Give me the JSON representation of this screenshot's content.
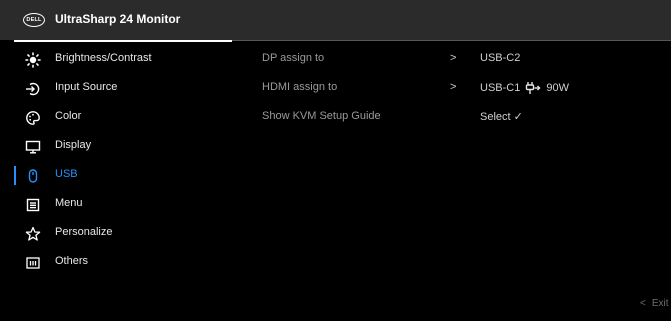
{
  "header": {
    "logo_text": "DELL",
    "title": "UltraSharp 24 Monitor"
  },
  "menu": [
    {
      "label": "Brightness/Contrast",
      "icon": "sun-icon"
    },
    {
      "label": "Input Source",
      "icon": "input-source-icon"
    },
    {
      "label": "Color",
      "icon": "palette-icon"
    },
    {
      "label": "Display",
      "icon": "monitor-icon"
    },
    {
      "label": "USB",
      "icon": "mouse-icon",
      "active": true
    },
    {
      "label": "Menu",
      "icon": "menu-icon"
    },
    {
      "label": "Personalize",
      "icon": "star-icon"
    },
    {
      "label": "Others",
      "icon": "info-icon"
    }
  ],
  "settings": [
    {
      "name": "DP assign to",
      "chevron": ">",
      "value": "USB-C2"
    },
    {
      "name": "HDMI assign to",
      "chevron": ">",
      "value": "USB-C1",
      "extra": "90W",
      "extra_icon": "power-plug-icon"
    },
    {
      "name": "Show KVM Setup Guide",
      "chevron": "",
      "value": "Select ✓"
    }
  ],
  "footer": {
    "exit_label": "Exit",
    "exit_chevron": "<"
  },
  "colors": {
    "accent": "#2a8ff7",
    "header_bg": "#2b2b2b",
    "bg": "#000000"
  }
}
